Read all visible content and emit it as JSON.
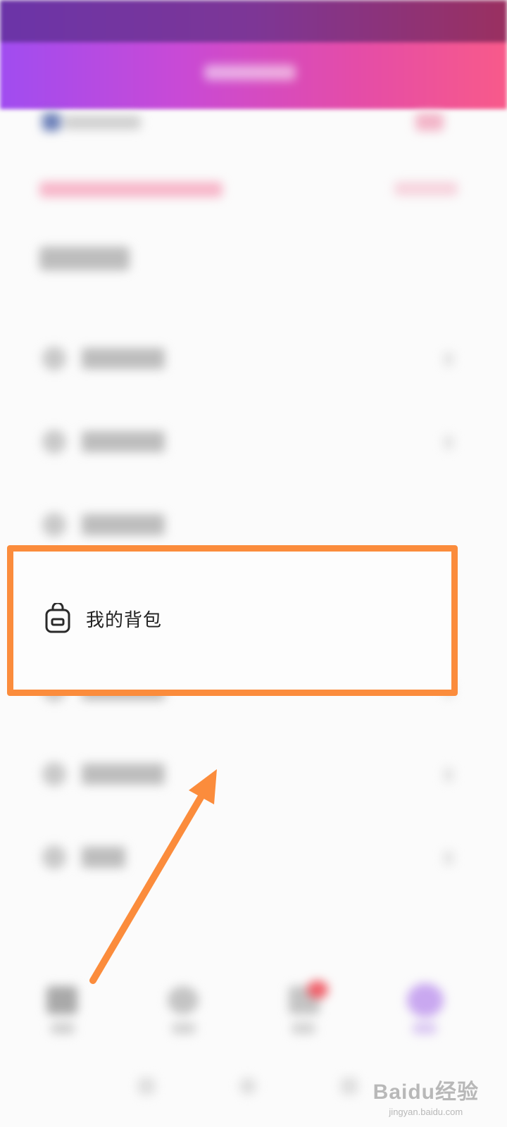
{
  "menu": {
    "highlighted_item": {
      "label": "我的背包",
      "icon": "backpack-icon"
    }
  },
  "annotation": {
    "box_color": "#fb8c3c",
    "arrow_color": "#fb8c3c"
  },
  "watermark": {
    "main": "Baidu经验",
    "sub": "jingyan.baidu.com"
  }
}
